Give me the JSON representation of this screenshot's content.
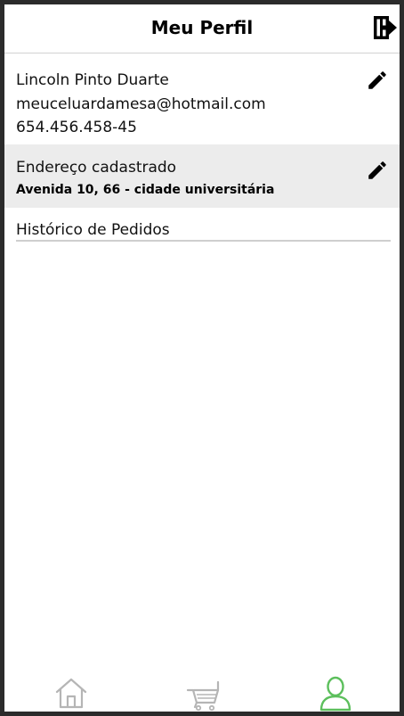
{
  "header": {
    "title": "Meu Perfil",
    "logout_icon": "logout-icon"
  },
  "profile": {
    "name": "Lincoln Pinto Duarte",
    "email": "meuceluardamesa@hotmail.com",
    "cpf": "654.456.458-45",
    "edit_icon": "pencil-icon"
  },
  "address": {
    "label": "Endereço cadastrado",
    "value": "Avenida 10, 66 - cidade universitária",
    "edit_icon": "pencil-icon"
  },
  "history": {
    "label": "Histórico de Pedidos"
  },
  "nav": {
    "items": [
      {
        "icon": "home-icon",
        "active": false
      },
      {
        "icon": "cart-icon",
        "active": false
      },
      {
        "icon": "user-icon",
        "active": true
      }
    ],
    "inactive_color": "#b5b5b5",
    "active_color": "#5cbf5c"
  }
}
